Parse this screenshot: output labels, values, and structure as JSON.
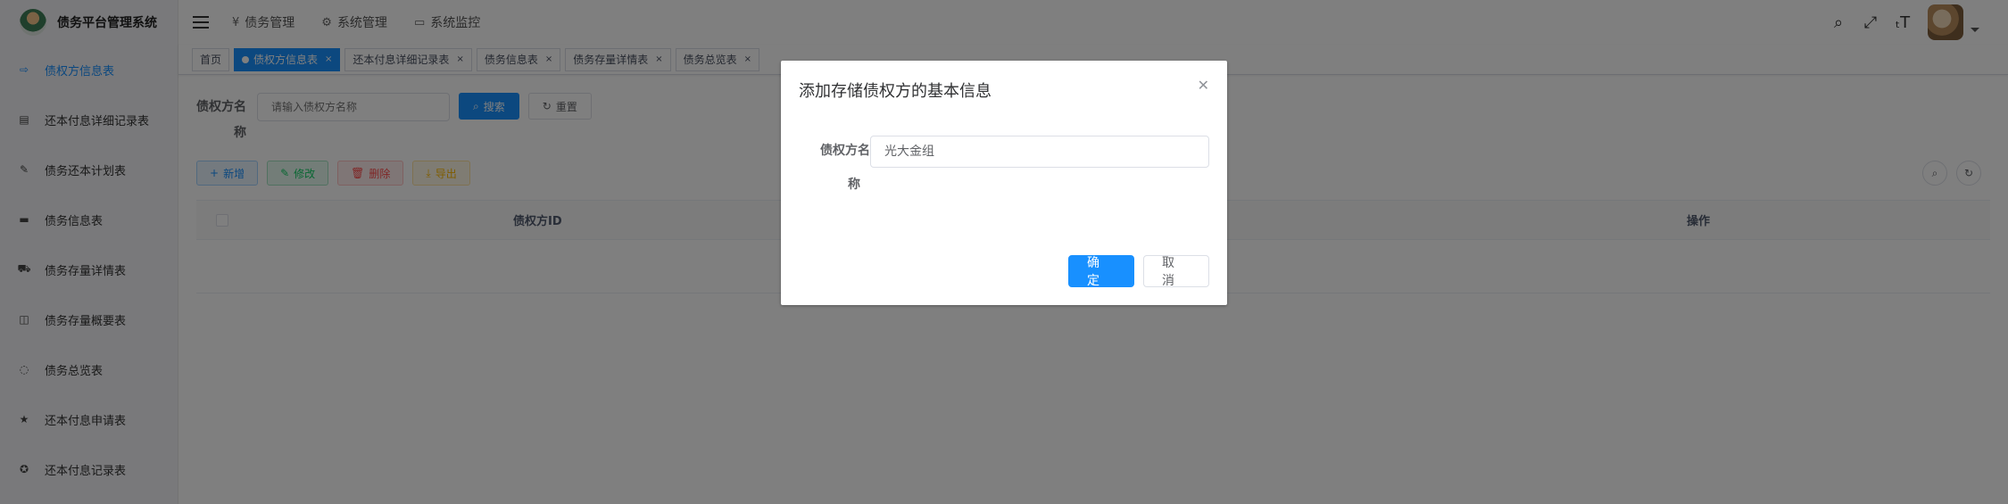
{
  "app": {
    "title": "债务平台管理系统"
  },
  "sidebar": {
    "items": [
      {
        "label": "债权方信息表",
        "icon": "link-icon",
        "active": true
      },
      {
        "label": "还本付息详细记录表",
        "icon": "document-icon",
        "active": false
      },
      {
        "label": "债务还本计划表",
        "icon": "edit-icon",
        "active": false
      },
      {
        "label": "债务信息表",
        "icon": "message-icon",
        "active": false
      },
      {
        "label": "债务存量详情表",
        "icon": "cart-icon",
        "active": false
      },
      {
        "label": "债务存量概要表",
        "icon": "book-icon",
        "active": false
      },
      {
        "label": "债务总览表",
        "icon": "circle-check-icon",
        "active": false
      },
      {
        "label": "还本付息申请表",
        "icon": "star-icon",
        "active": false
      },
      {
        "label": "还本付息记录表",
        "icon": "compass-icon",
        "active": false
      }
    ]
  },
  "topnav": {
    "items": [
      {
        "label": "债务管理",
        "icon": "yen-icon"
      },
      {
        "label": "系统管理",
        "icon": "gear-icon"
      },
      {
        "label": "系统监控",
        "icon": "monitor-icon"
      }
    ]
  },
  "tags": [
    {
      "label": "首页",
      "active": false,
      "closable": false
    },
    {
      "label": "债权方信息表",
      "active": true,
      "closable": true
    },
    {
      "label": "还本付息详细记录表",
      "active": false,
      "closable": true
    },
    {
      "label": "债务信息表",
      "active": false,
      "closable": true
    },
    {
      "label": "债务存量详情表",
      "active": false,
      "closable": true
    },
    {
      "label": "债务总览表",
      "active": false,
      "closable": true
    }
  ],
  "search": {
    "label_line1": "债权方名",
    "label_line2": "称",
    "placeholder": "请输入债权方名称",
    "search_button": "搜索",
    "reset_button": "重置"
  },
  "toolbar": {
    "add": "新增",
    "edit": "修改",
    "delete": "删除",
    "export": "导出"
  },
  "table": {
    "columns": [
      "债权方ID",
      "操作"
    ]
  },
  "dialog": {
    "title": "添加存储债权方的基本信息",
    "field_label_line1": "债权方名",
    "field_label_line2": "称",
    "field_value": "光大金组",
    "ok": "确 定",
    "cancel": "取 消"
  },
  "colors": {
    "primary": "#1890ff",
    "overlay": "rgba(0,0,0,0.5)"
  }
}
